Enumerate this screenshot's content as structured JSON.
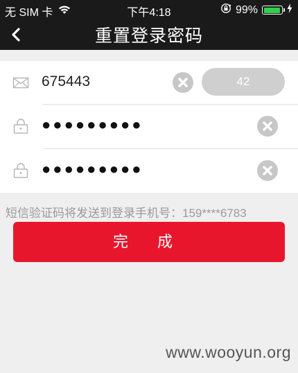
{
  "status_bar": {
    "carrier": "无 SIM 卡",
    "time": "下午4:18",
    "battery_percent": "99%",
    "battery_level": 0.99,
    "icons": [
      "wifi-icon",
      "rotation-lock-icon",
      "battery-icon",
      "charging-bolt-icon"
    ],
    "battery_color": "#2ed14a"
  },
  "nav": {
    "title": "重置登录密码",
    "back_icon": "chevron-left-icon"
  },
  "form": {
    "verification_code": {
      "value": "675443",
      "icon": "envelope-icon",
      "countdown_label": "42"
    },
    "new_password": {
      "masked_value": "●●●●●●●●●",
      "icon": "lock-icon"
    },
    "confirm_password": {
      "masked_value": "●●●●●●●●●",
      "icon": "lock-icon"
    },
    "clear_icon": "clear-x-icon"
  },
  "hint": "短信验证码将发送到登录手机号：159****6783",
  "submit_label": "完 成",
  "watermark": "www.wooyun.org",
  "colors": {
    "header_bg": "#1a1a1a",
    "primary_button": "#e8162c",
    "countdown_button": "#cfcfcf",
    "clear_button": "#c7c7c7",
    "hint_text": "#9a9a9a"
  }
}
